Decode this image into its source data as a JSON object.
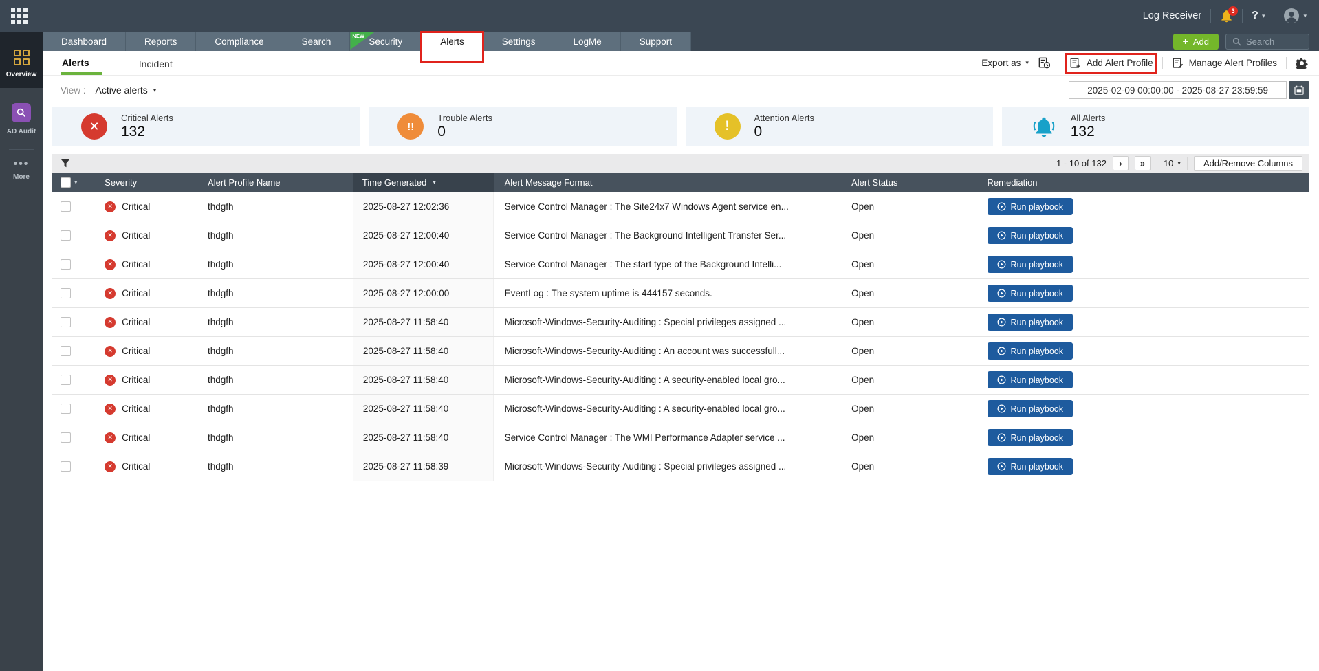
{
  "topbar": {
    "product_name": "Log Receiver",
    "notification_badge": "3",
    "help_label": "?"
  },
  "sidebar": {
    "items": [
      {
        "label": "Overview"
      },
      {
        "label": "AD Audit"
      },
      {
        "label": "More"
      }
    ]
  },
  "nav": {
    "tabs": [
      {
        "label": "Dashboard"
      },
      {
        "label": "Reports"
      },
      {
        "label": "Compliance"
      },
      {
        "label": "Search"
      },
      {
        "label": "Security",
        "badge": "NEW"
      },
      {
        "label": "Alerts",
        "active": true,
        "annotated": true
      },
      {
        "label": "Settings"
      },
      {
        "label": "LogMe"
      },
      {
        "label": "Support"
      }
    ],
    "add_button_label": "Add",
    "search_placeholder": "Search"
  },
  "subnav": {
    "tabs": [
      {
        "label": "Alerts",
        "active": true
      },
      {
        "label": "Incident"
      }
    ],
    "export_label": "Export as",
    "add_alert_profile_label": "Add Alert Profile",
    "manage_alert_profiles_label": "Manage Alert Profiles"
  },
  "filter_bar": {
    "view_label": "View :",
    "view_value": "Active alerts",
    "date_range": "2025-02-09 00:00:00 - 2025-08-27 23:59:59"
  },
  "summary_cards": [
    {
      "id": "critical",
      "label": "Critical Alerts",
      "value": "132",
      "color": "#d53a2f"
    },
    {
      "id": "trouble",
      "label": "Trouble Alerts",
      "value": "0",
      "color": "#ef8c3a"
    },
    {
      "id": "attention",
      "label": "Attention Alerts",
      "value": "0",
      "color": "#e5c128"
    },
    {
      "id": "all",
      "label": "All Alerts",
      "value": "132",
      "color": "#18a1c9"
    }
  ],
  "table": {
    "pagination": {
      "range": "1 - 10 of 132",
      "page_size": "10",
      "columns_button": "Add/Remove Columns"
    },
    "headers": {
      "severity": "Severity",
      "profile": "Alert Profile Name",
      "time": "Time Generated",
      "message": "Alert Message Format",
      "status": "Alert Status",
      "remediation": "Remediation"
    },
    "run_playbook_label": "Run playbook",
    "rows": [
      {
        "severity": "Critical",
        "profile": "thdgfh",
        "time": "2025-08-27 12:02:36",
        "message": "Service Control Manager : The Site24x7 Windows Agent service en...",
        "status": "Open"
      },
      {
        "severity": "Critical",
        "profile": "thdgfh",
        "time": "2025-08-27 12:00:40",
        "message": "Service Control Manager : The Background Intelligent Transfer Ser...",
        "status": "Open"
      },
      {
        "severity": "Critical",
        "profile": "thdgfh",
        "time": "2025-08-27 12:00:40",
        "message": "Service Control Manager : The start type of the Background Intelli...",
        "status": "Open"
      },
      {
        "severity": "Critical",
        "profile": "thdgfh",
        "time": "2025-08-27 12:00:00",
        "message": "EventLog : The system uptime is 444157 seconds.",
        "status": "Open"
      },
      {
        "severity": "Critical",
        "profile": "thdgfh",
        "time": "2025-08-27 11:58:40",
        "message": "Microsoft-Windows-Security-Auditing : Special privileges assigned ...",
        "status": "Open"
      },
      {
        "severity": "Critical",
        "profile": "thdgfh",
        "time": "2025-08-27 11:58:40",
        "message": "Microsoft-Windows-Security-Auditing : An account was successfull...",
        "status": "Open"
      },
      {
        "severity": "Critical",
        "profile": "thdgfh",
        "time": "2025-08-27 11:58:40",
        "message": "Microsoft-Windows-Security-Auditing : A security-enabled local gro...",
        "status": "Open"
      },
      {
        "severity": "Critical",
        "profile": "thdgfh",
        "time": "2025-08-27 11:58:40",
        "message": "Microsoft-Windows-Security-Auditing : A security-enabled local gro...",
        "status": "Open"
      },
      {
        "severity": "Critical",
        "profile": "thdgfh",
        "time": "2025-08-27 11:58:40",
        "message": "Service Control Manager : The WMI Performance Adapter service ...",
        "status": "Open"
      },
      {
        "severity": "Critical",
        "profile": "thdgfh",
        "time": "2025-08-27 11:58:39",
        "message": "Microsoft-Windows-Security-Auditing : Special privileges assigned ...",
        "status": "Open"
      }
    ]
  },
  "icons": {
    "caret_down": "▾",
    "next_page_icon": "›",
    "last_page_icon": "»",
    "critical_glyph": "✕",
    "trouble_glyph": "!!",
    "attention_glyph": "!",
    "more_dots": "•••",
    "add_plus": "+"
  },
  "colors": {
    "topbar_bg": "#3b4753",
    "sidebar_bg": "#3a424a",
    "tab_bg": "#5e6f7d",
    "annotation_red": "#e0231c",
    "new_badge_green": "#43b04a",
    "add_button_green": "#74b72a",
    "active_subtab_green": "#6bb33d",
    "table_header_bg": "#47525d",
    "sorted_column_bg": "#38424c",
    "card_bg": "#eff4f9",
    "run_playbook_blue": "#1e5b9e"
  }
}
